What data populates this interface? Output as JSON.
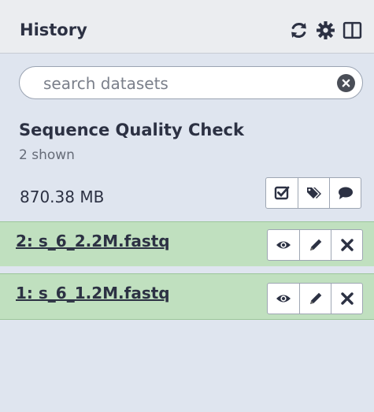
{
  "panel": {
    "title": "History",
    "header_icons": [
      "refresh-icon",
      "gear-icon",
      "columns-icon"
    ]
  },
  "search": {
    "placeholder": "search datasets",
    "value": ""
  },
  "history": {
    "name": "Sequence Quality Check",
    "shown": "2 shown",
    "size": "870.38 MB",
    "actions": [
      "check-square-icon",
      "tags-icon",
      "comment-icon"
    ]
  },
  "datasets": [
    {
      "hid_name": "2: s_6_2.2M.fastq",
      "actions": [
        "eye-icon",
        "pencil-icon",
        "delete-icon"
      ]
    },
    {
      "hid_name": "1: s_6_1.2M.fastq",
      "actions": [
        "eye-icon",
        "pencil-icon",
        "delete-icon"
      ]
    }
  ],
  "colors": {
    "panel_bg": "#dfe5ef",
    "header_bg": "#ebedf0",
    "dataset_ok_bg": "#c0e0bf",
    "text": "#2c3143"
  }
}
